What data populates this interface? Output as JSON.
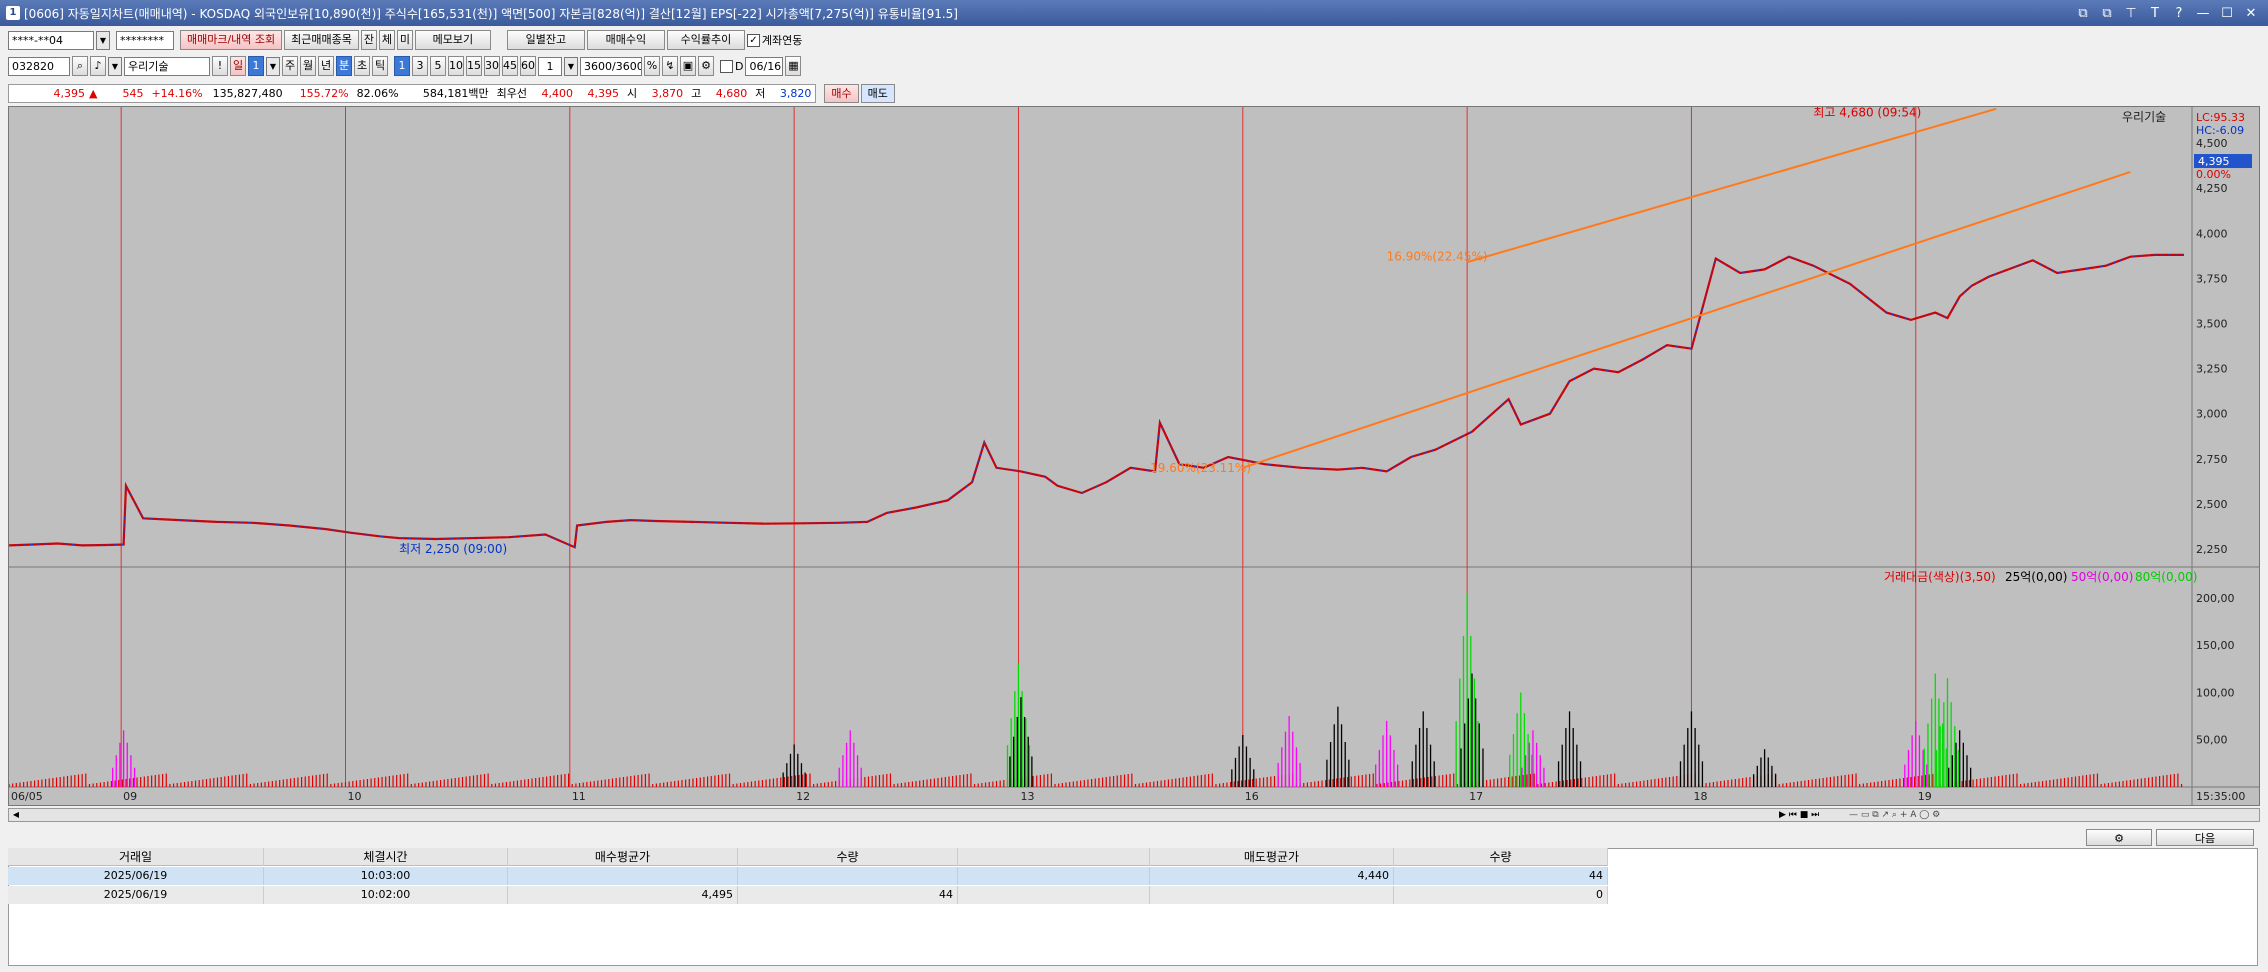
{
  "window": {
    "badge": "1",
    "title": "[0606] 자동일지차트(매매내역) - KOSDAQ 외국인보유[10,890(천)] 주식수[165,531(천)] 액면[500] 자본금[828(억)] 결산[12월] EPS[-22] 시가총액[7,275(억)] 유통비율[91.5]",
    "buttons": [
      "⧉",
      "⧉",
      "⊤",
      "T",
      "?",
      "—",
      "☐",
      "✕"
    ]
  },
  "toolbar1": {
    "account": "****-**04",
    "password": "********",
    "btn_mark": "매매마크/내역 조회",
    "btn_recent": "최근매매종목",
    "btn_jan": "잔",
    "btn_che": "체",
    "btn_mi": "미",
    "btn_memo": "메모보기",
    "btn_daily": "일별잔고",
    "btn_profit": "매매수익",
    "btn_rate": "수익률추이",
    "chk_link_label": "계좌연동",
    "chk_link_mark": "✓"
  },
  "toolbar2": {
    "code": "032820",
    "stock_name": "우리기술",
    "period_buttons": [
      "일",
      "1",
      "주",
      "월",
      "년",
      "분",
      "초",
      "틱"
    ],
    "minute_buttons": [
      "1",
      "3",
      "5",
      "10",
      "15",
      "30",
      "45",
      "60"
    ],
    "interval": "1",
    "count": "3600/3600",
    "d_label": "D",
    "date": "06/16"
  },
  "quote": {
    "price": "4,395",
    "arrow": "▲",
    "change": "545",
    "change_pct": "+14.16%",
    "volume": "135,827,480",
    "vol_pct": "155.72%",
    "ratio": "82.06%",
    "amount": "584,181백만",
    "best_label": "최우선",
    "ask": "4,400",
    "bid": "4,395",
    "open_label": "시",
    "open": "3,870",
    "high_label": "고",
    "high": "4,680",
    "low_label": "저",
    "low": "3,820",
    "buy": "매수",
    "sell": "매도"
  },
  "chart_data": {
    "type": "line",
    "title": "우리기술",
    "lc": "LC:95.33",
    "hc": "HC:-6.09",
    "current_price_label": "4,395",
    "current_pct_label": "0.00%",
    "ylim": [
      2150,
      4700
    ],
    "y_ticks": [
      "4,500",
      "4,250",
      "4,000",
      "3,750",
      "3,500",
      "3,250",
      "3,000",
      "2,750",
      "2,500",
      "2,250"
    ],
    "y_tick_values": [
      4500,
      4250,
      4000,
      3750,
      3500,
      3250,
      3000,
      2750,
      2500,
      2250
    ],
    "x": [
      0,
      10,
      20,
      30,
      40,
      47,
      48,
      55,
      70,
      85,
      100,
      115,
      130,
      140,
      152,
      160,
      175,
      190,
      205,
      220,
      232,
      233,
      245,
      255,
      265,
      280,
      295,
      310,
      325,
      340,
      352,
      360,
      372,
      385,
      395,
      400,
      405,
      415,
      425,
      430,
      440,
      450,
      460,
      470,
      472,
      480,
      490,
      500,
      515,
      530,
      545,
      555,
      565,
      575,
      585,
      600,
      615,
      620,
      632,
      640,
      650,
      660,
      670,
      680,
      690,
      700,
      710,
      720,
      730,
      740,
      755,
      770,
      780,
      790,
      795,
      800,
      805,
      812,
      820,
      830,
      840,
      850,
      860,
      870,
      880,
      892
    ],
    "values": [
      2270,
      2275,
      2280,
      2270,
      2272,
      2275,
      2600,
      2420,
      2410,
      2400,
      2395,
      2380,
      2360,
      2340,
      2320,
      2310,
      2305,
      2310,
      2315,
      2330,
      2260,
      2380,
      2400,
      2410,
      2405,
      2400,
      2395,
      2390,
      2392,
      2395,
      2400,
      2450,
      2480,
      2520,
      2620,
      2840,
      2700,
      2680,
      2650,
      2600,
      2560,
      2620,
      2700,
      2680,
      2950,
      2720,
      2700,
      2760,
      2720,
      2700,
      2690,
      2700,
      2680,
      2760,
      2800,
      2900,
      3080,
      2940,
      3000,
      3180,
      3250,
      3230,
      3300,
      3380,
      3360,
      3860,
      3780,
      3800,
      3870,
      3820,
      3720,
      3560,
      3520,
      3560,
      3530,
      3650,
      3710,
      3760,
      3800,
      3850,
      3780,
      3800,
      3820,
      3870,
      3880,
      3880
    ],
    "x_day_labels": [
      "06/05",
      "09",
      "10",
      "11",
      "12",
      "13",
      "16",
      "17",
      "18",
      "19"
    ],
    "x_day_pos": [
      0,
      46,
      138,
      230,
      322,
      414,
      506,
      598,
      690,
      782
    ],
    "time_label": "15:35:00",
    "annotations": {
      "high": "최고 4,680 (09:54)",
      "low": "최저 2,250 (09:00)",
      "seg1": "16.90%(22.45%)",
      "seg2": "19.60%(23.11%)"
    },
    "volume_legend": {
      "main": "거래대금(색상)(3,50)",
      "l25": "25억(0,00)",
      "l50": "50억(0,00)",
      "l80": "80억(0,00)"
    },
    "volume_ticks": [
      "200,00",
      "150,00",
      "100,00",
      "50,00"
    ],
    "volume_tick_values": [
      200,
      150,
      100,
      50
    ],
    "volume_max": 220,
    "volume_spikes": [
      {
        "x": 47,
        "v": 60,
        "c": "magenta"
      },
      {
        "x": 322,
        "v": 45,
        "c": "black"
      },
      {
        "x": 345,
        "v": 60,
        "c": "magenta"
      },
      {
        "x": 414,
        "v": 130,
        "c": "green"
      },
      {
        "x": 415,
        "v": 95,
        "c": "black"
      },
      {
        "x": 506,
        "v": 55,
        "c": "black"
      },
      {
        "x": 525,
        "v": 75,
        "c": "magenta"
      },
      {
        "x": 545,
        "v": 85,
        "c": "black"
      },
      {
        "x": 565,
        "v": 70,
        "c": "magenta"
      },
      {
        "x": 580,
        "v": 80,
        "c": "black"
      },
      {
        "x": 598,
        "v": 205,
        "c": "green"
      },
      {
        "x": 600,
        "v": 120,
        "c": "black"
      },
      {
        "x": 620,
        "v": 100,
        "c": "green"
      },
      {
        "x": 625,
        "v": 60,
        "c": "magenta"
      },
      {
        "x": 640,
        "v": 80,
        "c": "black"
      },
      {
        "x": 690,
        "v": 80,
        "c": "black"
      },
      {
        "x": 720,
        "v": 40,
        "c": "black"
      },
      {
        "x": 782,
        "v": 70,
        "c": "magenta"
      },
      {
        "x": 790,
        "v": 120,
        "c": "green"
      },
      {
        "x": 795,
        "v": 115,
        "c": "green"
      },
      {
        "x": 800,
        "v": 60,
        "c": "black"
      }
    ],
    "trendlines": [
      {
        "x1": 506,
        "y1": 2700,
        "x2": 870,
        "y2": 4340
      },
      {
        "x1": 598,
        "y1": 3840,
        "x2": 815,
        "y2": 4690
      }
    ]
  },
  "grid": {
    "headers": [
      "거래일",
      "체결시간",
      "매수평균가",
      "수량",
      "",
      "매도평균가",
      "수량"
    ],
    "rows": [
      [
        "2025/06/19",
        "10:03:00",
        "",
        "",
        "",
        "4,440",
        "44"
      ],
      [
        "2025/06/19",
        "10:02:00",
        "4,495",
        "44",
        "",
        "",
        "0"
      ]
    ],
    "btn_next": "다음"
  },
  "colors": {
    "price_up": "#d00000",
    "price_line_blue": "#1f3fcf",
    "trendline": "#ff7a1a",
    "volume_red": "#e00000",
    "volume_green": "#00dd00",
    "volume_magenta": "#ff00ff"
  }
}
